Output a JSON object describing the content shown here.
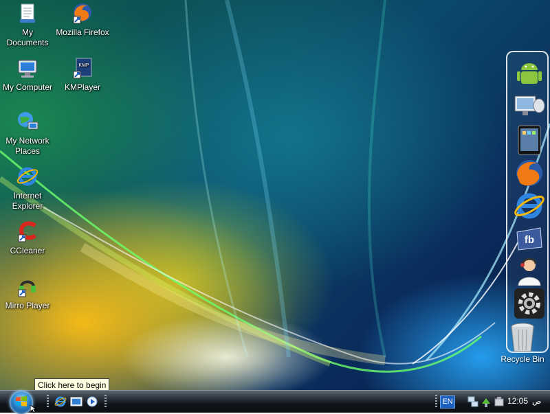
{
  "desktop": {
    "icons": [
      {
        "label": "My\nDocuments",
        "icon": "documents-icon"
      },
      {
        "label": "Mozilla Firefox",
        "icon": "firefox-shortcut-icon"
      },
      {
        "label": "My Computer",
        "icon": "computer-icon"
      },
      {
        "label": "KMPlayer",
        "icon": "kmplayer-shortcut-icon"
      },
      {
        "label": "My Network\nPlaces",
        "icon": "network-places-icon"
      },
      {
        "label": "Internet\nExplorer",
        "icon": "internet-explorer-icon"
      },
      {
        "label": "CCleaner",
        "icon": "ccleaner-shortcut-icon"
      },
      {
        "label": "Mirro Player",
        "icon": "mirro-player-shortcut-icon"
      }
    ]
  },
  "dock": {
    "items": [
      {
        "icon": "android-icon"
      },
      {
        "icon": "monitor-network-icon"
      },
      {
        "icon": "ipad-icon"
      },
      {
        "icon": "firefox-icon"
      },
      {
        "icon": "internet-explorer-icon"
      },
      {
        "icon": "facebook-icon"
      },
      {
        "icon": "support-agent-icon"
      },
      {
        "icon": "settings-gear-icon"
      }
    ],
    "recycle_bin": {
      "label": "Recycle Bin",
      "icon": "recycle-bin-icon"
    }
  },
  "tooltip": {
    "text": "Click here to begin"
  },
  "taskbar": {
    "start_button": {
      "icon": "windows-start-orb-icon"
    },
    "quick_launch": [
      {
        "icon": "internet-explorer-icon"
      },
      {
        "icon": "show-desktop-icon"
      },
      {
        "icon": "media-player-icon"
      }
    ],
    "language": "EN",
    "tray_icons": [
      "network-icon",
      "safely-remove-hardware-icon",
      "volume-icon"
    ],
    "clock": "12:05",
    "am_pm": "ص"
  },
  "colors": {
    "taskbar": "#11161c",
    "tooltip_bg": "#ffffe1",
    "accent_blue": "#2b82c9",
    "lang_bg": "#1b5fbf"
  }
}
